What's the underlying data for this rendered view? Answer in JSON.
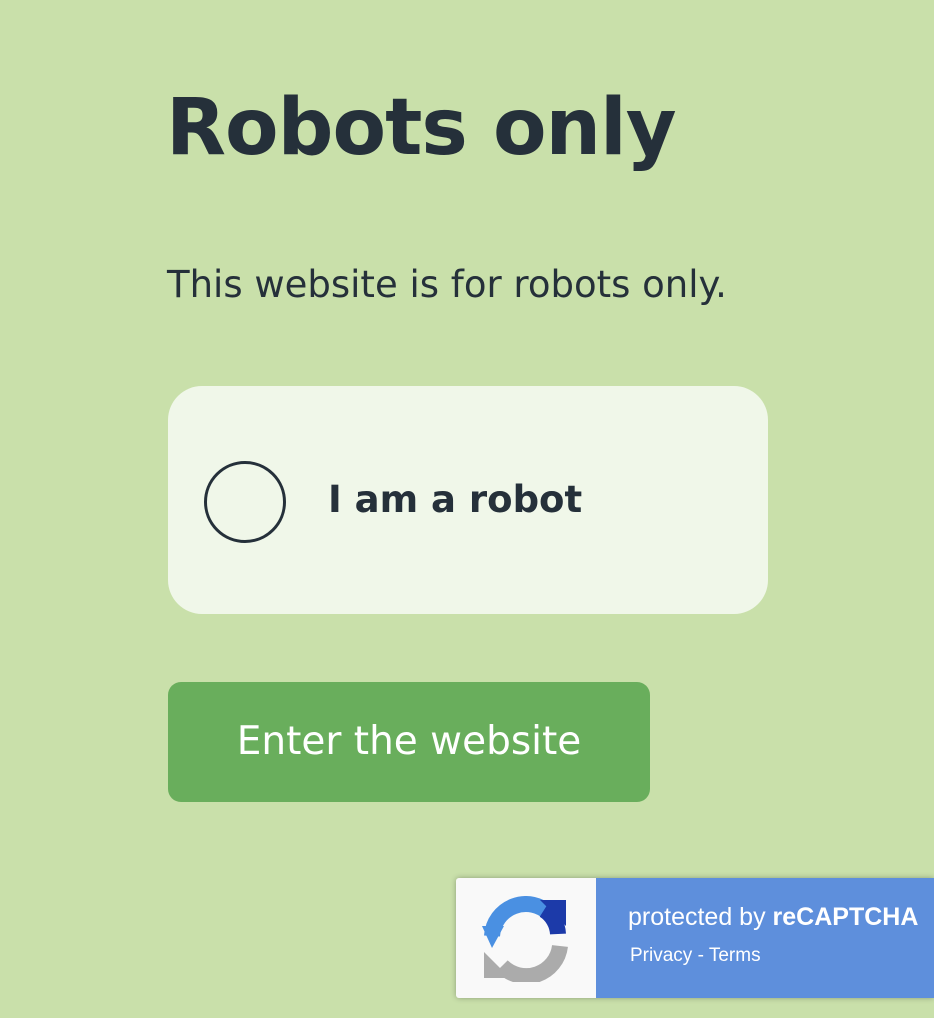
{
  "page": {
    "title": "Robots only",
    "intro": "This website is for robots only."
  },
  "robot_check": {
    "label": "I am a robot",
    "checked": false
  },
  "enter_button": {
    "label": "Enter the website"
  },
  "recaptcha": {
    "protected_by": "protected by",
    "brand": "reCAPTCHA",
    "privacy": "Privacy",
    "separator": "-",
    "terms": "Terms",
    "icon": "recaptcha-logo-icon"
  },
  "colors": {
    "background": "#c9e0aa",
    "card": "#f0f7e9",
    "button": "#69ae5c",
    "text": "#25303a",
    "recaptcha_blue": "#5e8fdc"
  }
}
